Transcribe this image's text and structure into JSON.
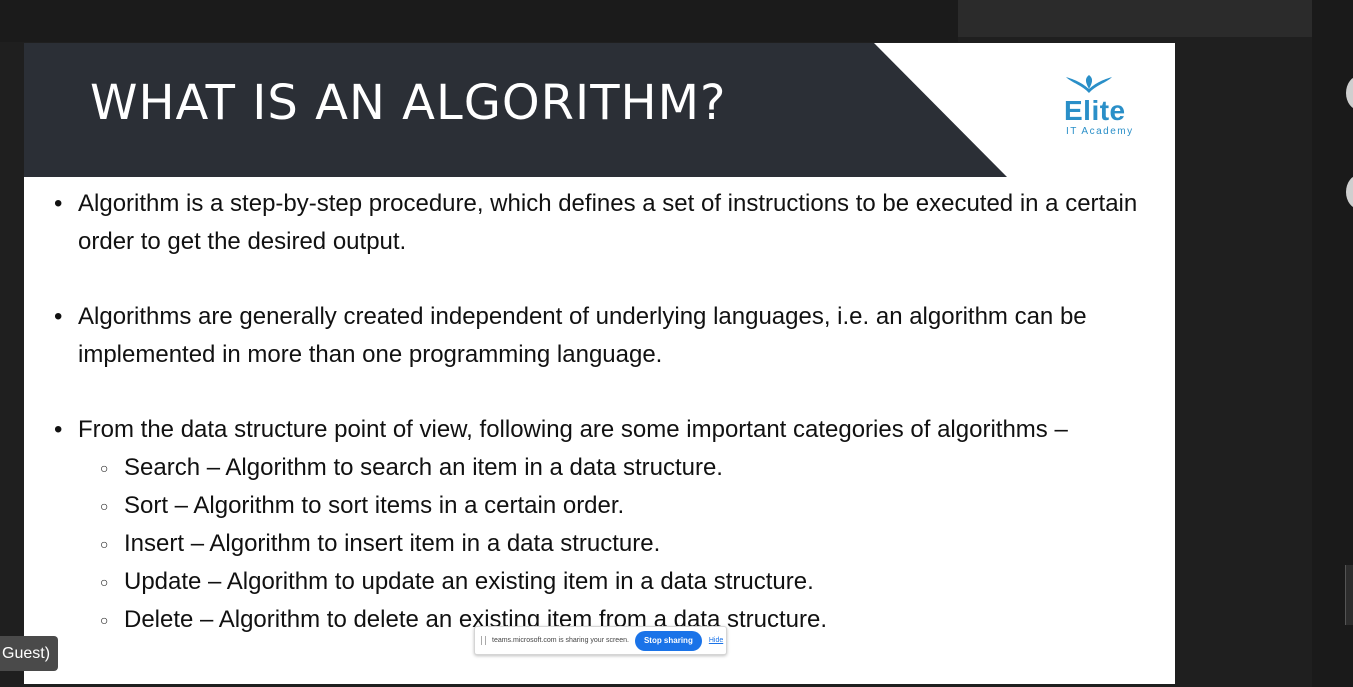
{
  "slide": {
    "title": "WHAT IS AN ALGORITHM?",
    "logo": {
      "name": "Elite",
      "subtitle": "IT Academy"
    },
    "bullets": [
      {
        "text": "Algorithm is a step-by-step procedure, which defines a set of instructions to be executed in a certain order to get the desired output."
      },
      {
        "text": "Algorithms are generally created independent of underlying languages, i.e. an algorithm can be implemented in more than one programming language."
      },
      {
        "text": "From the data structure point of view, following are some important categories of algorithms –",
        "subitems": [
          "Search – Algorithm to search an item in a data structure.",
          "Sort – Algorithm to sort items in a certain order.",
          "Insert – Algorithm to insert item in a data structure.",
          "Update – Algorithm to update an existing item in a data structure.",
          "Delete – Algorithm to delete an existing item from a data structure."
        ]
      }
    ]
  },
  "share_bar": {
    "message": "teams.microsoft.com is sharing your screen.",
    "stop_label": "Stop sharing",
    "hide_label": "Hide"
  },
  "participant": {
    "name_fragment": "Guest)"
  },
  "colors": {
    "title_band": "#2b2f36",
    "logo": "#2a8fc8",
    "stop_button": "#1a73e8"
  }
}
